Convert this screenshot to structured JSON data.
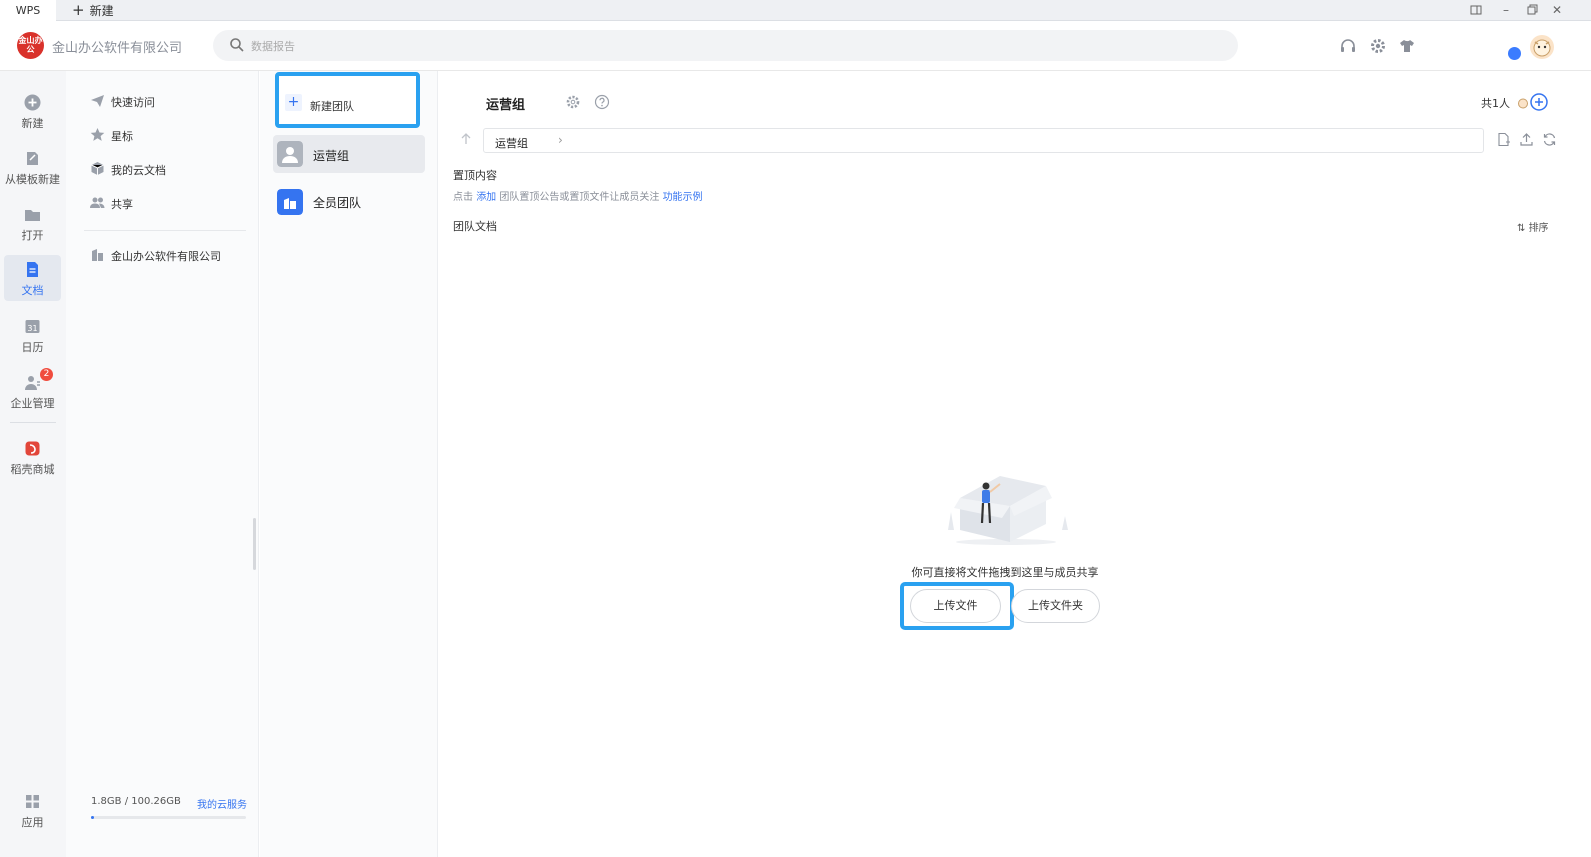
{
  "titlebar": {
    "app_tab": "WPS",
    "new_tab": "新建"
  },
  "header": {
    "logo_text": "金山办公",
    "org_name": "金山办公软件有限公司",
    "search_placeholder": "数据报告"
  },
  "leftnav": {
    "items": [
      {
        "label": "新建",
        "icon": "plus-circle-icon"
      },
      {
        "label": "从模板新建",
        "icon": "template-icon"
      },
      {
        "label": "打开",
        "icon": "folder-icon"
      },
      {
        "label": "文档",
        "icon": "document-icon",
        "active": true
      },
      {
        "label": "日历",
        "icon": "calendar-icon",
        "icon_text": "31"
      },
      {
        "label": "企业管理",
        "icon": "enterprise-icon",
        "badge": "2"
      },
      {
        "label": "稻壳商城",
        "icon": "docer-icon"
      },
      {
        "label": "应用",
        "icon": "apps-icon"
      }
    ]
  },
  "sidebar": {
    "items": [
      {
        "label": "快速访问",
        "icon": "paper-plane-icon"
      },
      {
        "label": "星标",
        "icon": "star-icon"
      },
      {
        "label": "我的云文档",
        "icon": "cloud-box-icon"
      },
      {
        "label": "共享",
        "icon": "people-icon"
      },
      {
        "label": "金山办公软件有限公司",
        "icon": "building-icon"
      }
    ],
    "storage": "1.8GB / 100.26GB",
    "cloud_service": "我的云服务"
  },
  "teams": {
    "new_team": "新建团队",
    "items": [
      {
        "label": "运营组",
        "active": true
      },
      {
        "label": "全员团队",
        "active": false
      }
    ]
  },
  "main": {
    "title": "运营组",
    "member_count": "共1人",
    "path": "运营组",
    "pinned_title": "置顶内容",
    "pinned_hint_prefix": "点击",
    "pinned_hint_add": "添加",
    "pinned_hint_middle": "团队置顶公告或置顶文件让成员关注",
    "pinned_hint_example": "功能示例",
    "team_docs": "团队文档",
    "sort": "排序",
    "empty_text": "你可直接将文件拖拽到这里与成员共享",
    "upload_file": "上传文件",
    "upload_folder": "上传文件夹"
  },
  "colors": {
    "accent": "#3574f0",
    "highlight": "#2aa1f0",
    "logo_red": "#d9322b"
  }
}
